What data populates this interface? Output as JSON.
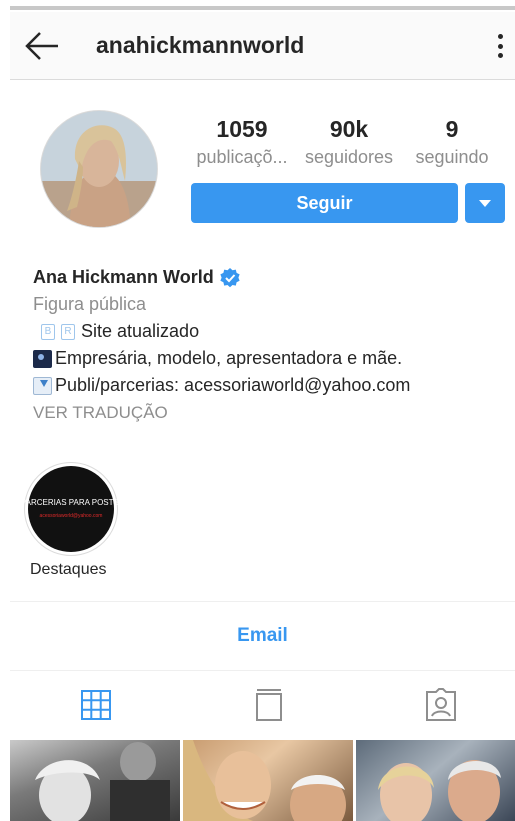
{
  "header": {
    "title": "anahickmannworld"
  },
  "stats": {
    "posts": {
      "value": "1059",
      "label": "publicaçõ..."
    },
    "followers": {
      "value": "90k",
      "label": "seguidores"
    },
    "following": {
      "value": "9",
      "label": "seguindo"
    }
  },
  "actions": {
    "follow_label": "Seguir"
  },
  "bio": {
    "name": "Ana Hickmann World",
    "category": "Figura pública",
    "line1": "Site atualizado",
    "line2": "Empresária, modelo, apresentadora e mãe.",
    "line3": "Publi/parcerias: acessoriaworld@yahoo.com",
    "translate": "VER TRADUÇÃO"
  },
  "highlights": [
    {
      "label": "Destaques",
      "cover_line1": "PARCERIAS PARA POSTS.",
      "cover_line2": "acessoriaworld@yahoo.com"
    }
  ],
  "contact": {
    "email_label": "Email"
  },
  "tabs": [
    {
      "name": "grid",
      "icon": "grid-icon",
      "active": true
    },
    {
      "name": "feed",
      "icon": "feed-icon",
      "active": false
    },
    {
      "name": "tagged",
      "icon": "tagged-icon",
      "active": false
    }
  ],
  "colors": {
    "accent": "#3897f0",
    "text": "#262626",
    "muted": "#8e8e8e",
    "verified": "#3897f0"
  }
}
